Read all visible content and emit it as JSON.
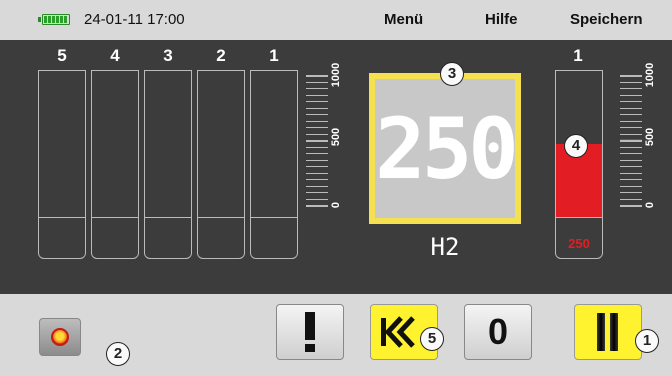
{
  "status": {
    "battery_icon": "battery-icon",
    "datetime": "24-01-11 17:00"
  },
  "menu": {
    "items": [
      "Menü",
      "Hilfe",
      "Speichern"
    ]
  },
  "channels": {
    "labels": [
      "5",
      "4",
      "3",
      "2",
      "1"
    ],
    "values": [
      0,
      0,
      0,
      0,
      0
    ]
  },
  "left_scale": {
    "ticks": [
      "0",
      "500",
      "1000"
    ],
    "max": 1000
  },
  "display": {
    "value": "250",
    "label": "H2",
    "frame_color": "#f5e050"
  },
  "right_channel": {
    "label": "1",
    "value": 250,
    "value_text": "250",
    "fill_color": "#e31d24",
    "marker_value": 500
  },
  "right_scale": {
    "ticks": [
      "0",
      "500",
      "1000"
    ],
    "max": 1000
  },
  "badges": [
    "1",
    "2",
    "3",
    "4",
    "5"
  ],
  "buttons": {
    "record": "record-button",
    "alert": "alert-button",
    "rewind": "rewind-button",
    "zero_label": "0",
    "pause": "pause-button"
  },
  "colors": {
    "panel": "#3c3c3c",
    "accent_yellow": "#fff22e",
    "alarm_red": "#e31d24"
  }
}
